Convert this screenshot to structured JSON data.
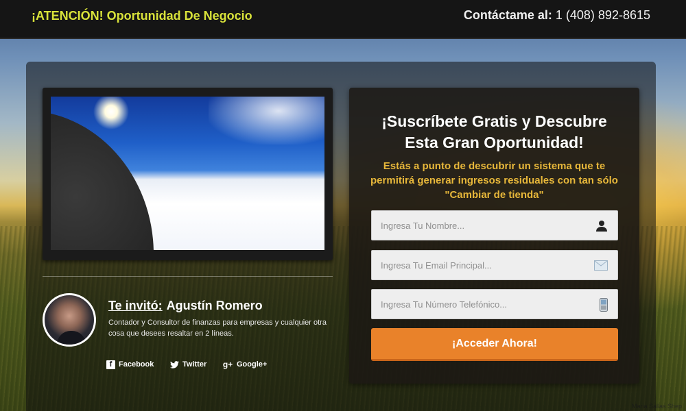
{
  "header": {
    "brand": "¡ATENCIÓN! Oportunidad De Negocio",
    "contact_label": "Contáctame al:",
    "contact_phone": "1 (408) 892-8615"
  },
  "video": {
    "description": "Embedded intro video"
  },
  "profile": {
    "invite_prefix": "Te invitó:",
    "name": "Agustín Romero",
    "description": "Contador y Consultor de finanzas para empresas y cualquier otra cosa que desees resaltar en 2 líneas."
  },
  "social": {
    "facebook": "Facebook",
    "twitter": "Twitter",
    "googleplus": "Google+"
  },
  "form": {
    "title_line1": "¡Suscríbete Gratis y Descubre",
    "title_line2": "Esta Gran Oportunidad!",
    "subtitle": "Estás a punto de descubrir un sistema que te permitirá generar ingresos residuales con tan sólo \"Cambiar de tienda\"",
    "name_placeholder": "Ingresa Tu Nombre...",
    "email_placeholder": "Ingresa Tu Email Principal...",
    "phone_placeholder": "Ingresa Tu Número Telefónico...",
    "submit_label": "¡Acceder Ahora!"
  },
  "background_credit": "Maria Sallas Shep",
  "colors": {
    "brand_accent": "#d8e23a",
    "subtitle_accent": "#e7b73a",
    "button": "#e9822a"
  }
}
